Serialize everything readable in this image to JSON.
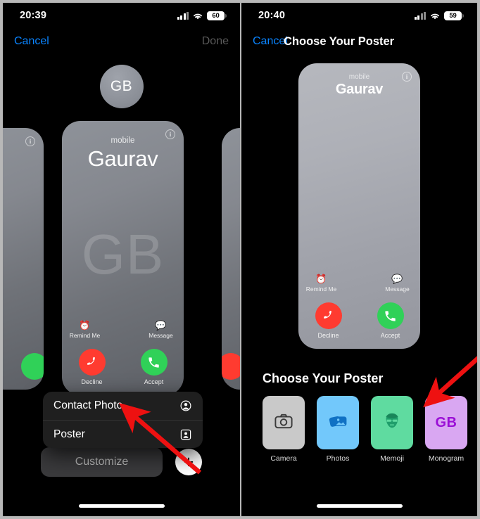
{
  "left_phone": {
    "status": {
      "time": "20:39",
      "battery": "60",
      "signal_icon": "cellular-bars-icon",
      "wifi_icon": "wifi-icon"
    },
    "nav": {
      "cancel_label": "Cancel",
      "done_label": "Done"
    },
    "avatar": {
      "initials": "GB"
    },
    "poster_card": {
      "label": "mobile",
      "name": "Gaurav",
      "monogram": "GB",
      "info_glyph": "i",
      "remind_label": "Remind Me",
      "message_label": "Message",
      "decline_label": "Decline",
      "accept_label": "Accept"
    },
    "context_menu": {
      "items": [
        {
          "label": "Contact Photo",
          "icon": "person-circle-icon"
        },
        {
          "label": "Poster",
          "icon": "person-card-icon"
        }
      ]
    },
    "customize_label": "Customize",
    "add_label": "+"
  },
  "right_phone": {
    "status": {
      "time": "20:40",
      "battery": "59",
      "signal_icon": "cellular-bars-icon",
      "wifi_icon": "wifi-icon"
    },
    "nav": {
      "cancel_label": "Cancel",
      "title": "Choose Your Poster"
    },
    "poster_card": {
      "label": "mobile",
      "name": "Gaurav",
      "info_glyph": "i",
      "remind_label": "Remind Me",
      "message_label": "Message",
      "decline_label": "Decline",
      "accept_label": "Accept"
    },
    "section_title": "Choose Your Poster",
    "tiles": [
      {
        "label": "Camera",
        "icon": "camera-icon",
        "bg": "#c9c9c9",
        "fg": "#3a3a3a",
        "text": ""
      },
      {
        "label": "Photos",
        "icon": "photos-icon",
        "bg": "#72c8fb",
        "fg": "#1071c4",
        "text": ""
      },
      {
        "label": "Memoji",
        "icon": "memoji-icon",
        "bg": "#5fdba0",
        "fg": "#1f9e6b",
        "text": ""
      },
      {
        "label": "Monogram",
        "icon": "monogram-initials",
        "bg": "#d9a7f2",
        "fg": "#9b0fd6",
        "text": "GB"
      }
    ]
  },
  "colors": {
    "accent_blue": "#0a84ff",
    "decline_red": "#ff3b30",
    "accept_green": "#30d158",
    "arrow_red": "#ee1111"
  }
}
